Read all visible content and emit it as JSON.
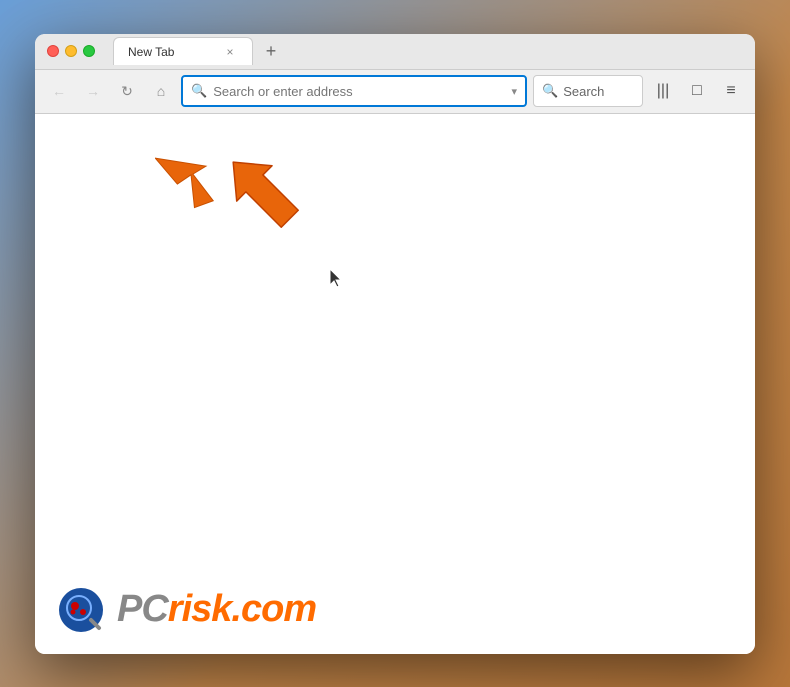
{
  "titleBar": {
    "tabTitle": "New Tab",
    "closeLabel": "×",
    "newTabLabel": "+"
  },
  "navBar": {
    "backButton": "←",
    "forwardButton": "→",
    "reloadButton": "↻",
    "homeButton": "⌂",
    "addressPlaceholder": "Search or enter address",
    "dropdownIcon": "▾",
    "searchLabel": "Search",
    "libraryIcon": "|||",
    "sidebarIcon": "□",
    "menuIcon": "≡"
  },
  "watermark": {
    "logoText": "PC",
    "logoRisk": "risk",
    "logoDotCom": ".com"
  },
  "arrow": {
    "color": "#e8650a"
  }
}
